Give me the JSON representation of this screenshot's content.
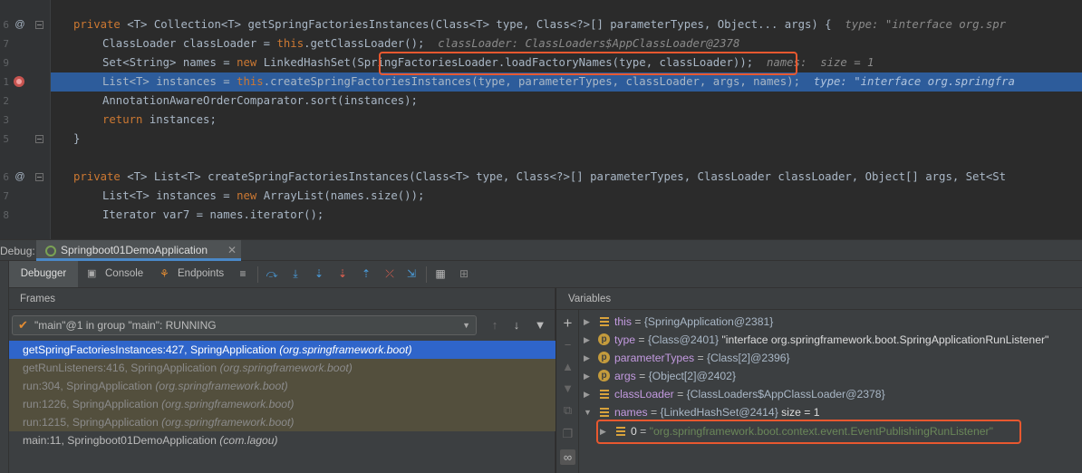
{
  "editor": {
    "lines": [
      {
        "num": "6",
        "gutter": "@",
        "fold": true
      },
      {
        "num": "7",
        "gutter": "",
        "fold": false
      },
      {
        "num": "9",
        "gutter": "",
        "fold": false
      },
      {
        "num": "1",
        "gutter": "breakpoint",
        "fold": false
      },
      {
        "num": "2",
        "gutter": "",
        "fold": false
      },
      {
        "num": "3",
        "gutter": "",
        "fold": false
      },
      {
        "num": "5",
        "gutter": "",
        "fold": true
      },
      {
        "num": "",
        "gutter": "",
        "fold": false
      },
      {
        "num": "6",
        "gutter": "@",
        "fold": true
      },
      {
        "num": "7",
        "gutter": "",
        "fold": false
      },
      {
        "num": "8",
        "gutter": "",
        "fold": false
      },
      {
        "num": "",
        "gutter": "",
        "fold": false
      }
    ],
    "code": {
      "l1_kw": "private",
      "l1_a": " <T> Collection<T> getSpringFactoriesInstances(Class<T> type, Class<?>[] parameterTypes, Object... args) {",
      "l1_hint": "  type: \"interface org.spr",
      "l2_a": "ClassLoader classLoader = ",
      "l2_kw": "this",
      "l2_b": ".getClassLoader();",
      "l2_hint": "  classLoader: ClassLoaders$AppClassLoader@2378",
      "l3_a": "Set<String> names = ",
      "l3_kw": "new",
      "l3_b": " LinkedHashSet(SpringFactoriesLoader.loadFactoryNames(type, classLoader));",
      "l3_hint": "  names:  size = 1",
      "l4_a": "List<T> instances = ",
      "l4_kw": "this",
      "l4_b": ".createSpringFactoriesInstances(type, parameterTypes, classLoader, args, names);",
      "l4_hint": "  type: \"interface org.springfra",
      "l5_a": "AnnotationAwareOrderComparator.sort(instances);",
      "l6_kw": "return",
      "l6_b": " instances;",
      "l7": "}",
      "l9_kw": "private",
      "l9_a": " <T> List<T> createSpringFactoriesInstances(Class<T> type, Class<?>[] parameterTypes, ClassLoader classLoader, Object[] args, Set<St",
      "l10_a": "List<T> instances = ",
      "l10_kw": "new",
      "l10_b": " ArrayList(names.size());",
      "l11_a": "Iterator var7 = names.iterator();"
    }
  },
  "debug": {
    "label": "Debug:",
    "run_tab": "Springboot01DemoApplication",
    "tabs": [
      "Debugger",
      "Console",
      "Endpoints"
    ],
    "frames_header": "Frames",
    "thread": "\"main\"@1 in group \"main\": RUNNING",
    "frames": [
      {
        "method": "getSpringFactoriesInstances:427, SpringApplication",
        "pkg": "(org.springframework.boot)",
        "kind": "sel"
      },
      {
        "method": "getRunListeners:416, SpringApplication",
        "pkg": "(org.springframework.boot)",
        "kind": "lib"
      },
      {
        "method": "run:304, SpringApplication",
        "pkg": "(org.springframework.boot)",
        "kind": "lib"
      },
      {
        "method": "run:1226, SpringApplication",
        "pkg": "(org.springframework.boot)",
        "kind": "lib"
      },
      {
        "method": "run:1215, SpringApplication",
        "pkg": "(org.springframework.boot)",
        "kind": "lib"
      },
      {
        "method": "main:11, Springboot01DemoApplication",
        "pkg": "(com.lagou)",
        "kind": "normal"
      }
    ],
    "variables_header": "Variables",
    "variables": [
      {
        "name": "this",
        "value": "{SpringApplication@2381}",
        "icon": "field",
        "extra": ""
      },
      {
        "name": "type",
        "value": "{Class@2401}",
        "icon": "param",
        "extra": "\"interface org.springframework.boot.SpringApplicationRunListener\""
      },
      {
        "name": "parameterTypes",
        "value": "{Class[2]@2396}",
        "icon": "param",
        "extra": ""
      },
      {
        "name": "args",
        "value": "{Object[2]@2402}",
        "icon": "param",
        "extra": ""
      },
      {
        "name": "classLoader",
        "value": "{ClassLoaders$AppClassLoader@2378}",
        "icon": "field",
        "extra": ""
      },
      {
        "name": "names",
        "value": "{LinkedHashSet@2414}",
        "icon": "field",
        "extra": " size = 1"
      }
    ],
    "child": {
      "name": "0",
      "value": "\"org.springframework.boot.context.event.EventPublishingRunListener\""
    }
  }
}
